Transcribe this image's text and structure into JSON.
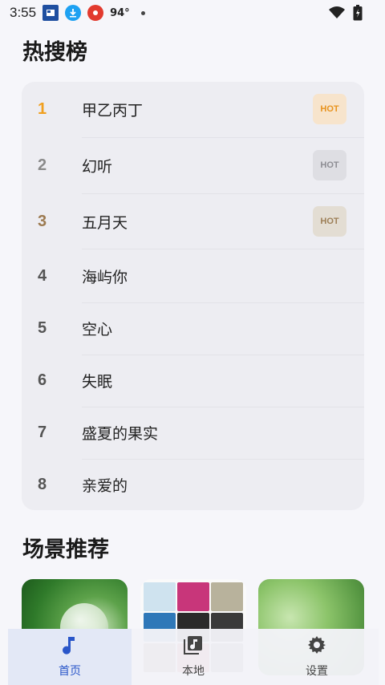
{
  "status_bar": {
    "time": "3:55",
    "temperature": "94°",
    "icons": [
      "news-icon",
      "download-icon",
      "app-icon",
      "wifi-icon",
      "battery-icon"
    ]
  },
  "hot_search": {
    "title": "热搜榜",
    "items": [
      {
        "rank": "1",
        "name": "甲乙丙丁",
        "badge": "HOT",
        "rank_color": "#f0a020",
        "badge_bg": "#f7e4cc",
        "badge_color": "#e8931e"
      },
      {
        "rank": "2",
        "name": "幻听",
        "badge": "HOT",
        "rank_color": "#8a8a8a",
        "badge_bg": "#dedee3",
        "badge_color": "#8d8d93"
      },
      {
        "rank": "3",
        "name": "五月天",
        "badge": "HOT",
        "rank_color": "#9c7a50",
        "badge_bg": "#e3ddd3",
        "badge_color": "#9d7f57"
      },
      {
        "rank": "4",
        "name": "海屿你",
        "badge": "",
        "rank_color": "#555555"
      },
      {
        "rank": "5",
        "name": "空心",
        "badge": "",
        "rank_color": "#555555"
      },
      {
        "rank": "6",
        "name": "失眠",
        "badge": "",
        "rank_color": "#555555"
      },
      {
        "rank": "7",
        "name": "盛夏的果实",
        "badge": "",
        "rank_color": "#555555"
      },
      {
        "rank": "8",
        "name": "亲爱的",
        "badge": "",
        "rank_color": "#555555"
      }
    ]
  },
  "scene": {
    "title": "场景推荐"
  },
  "bottom_nav": {
    "items": [
      {
        "label": "首页",
        "icon": "music-note-icon",
        "active": true
      },
      {
        "label": "本地",
        "icon": "music-library-icon",
        "active": false
      },
      {
        "label": "设置",
        "icon": "gear-icon",
        "active": false
      }
    ]
  },
  "colors": {
    "accent": "#2a56c9",
    "background": "#f6f6fa",
    "card": "#ededf2"
  }
}
